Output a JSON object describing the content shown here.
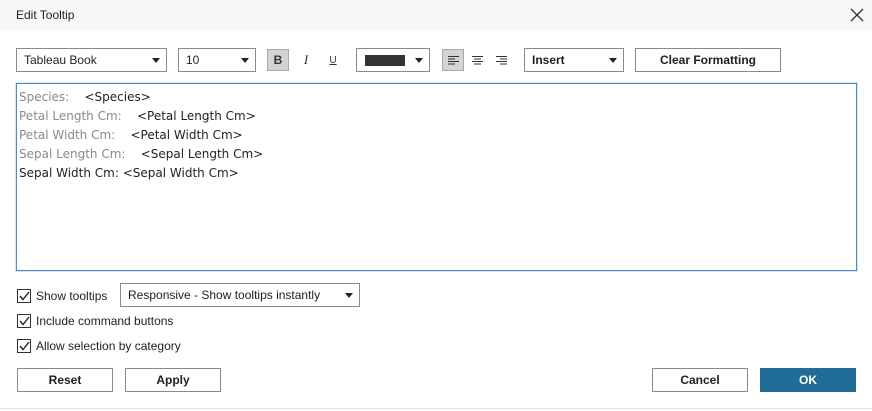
{
  "window": {
    "title": "Edit Tooltip",
    "close_icon": "close-icon"
  },
  "toolbar": {
    "font_family": "Tableau Book",
    "font_size": "10",
    "bold_label": "B",
    "italic_label": "I",
    "underline_label": "U",
    "text_color": "#333333",
    "align_left_icon": "align-left-icon",
    "align_center_icon": "align-center-icon",
    "align_right_icon": "align-right-icon",
    "insert_label": "Insert",
    "clear_formatting_label": "Clear Formatting"
  },
  "editor": {
    "lines": [
      {
        "label": "Species:",
        "field": "<Species>"
      },
      {
        "label": "Petal Length Cm:",
        "field": "<Petal Length Cm>"
      },
      {
        "label": "Petal Width Cm:",
        "field": "<Petal Width Cm>"
      },
      {
        "label": "Sepal Length Cm:",
        "field": "<Sepal Length Cm>"
      },
      {
        "label": "Sepal Width Cm:",
        "field": "<Sepal Width Cm>"
      }
    ]
  },
  "options": {
    "show_tooltips_label": "Show tooltips",
    "show_tooltips_checked": true,
    "tooltip_mode": "Responsive - Show tooltips instantly",
    "include_command_buttons_label": "Include command buttons",
    "include_command_buttons_checked": true,
    "allow_selection_label": "Allow selection by category",
    "allow_selection_checked": true
  },
  "footer": {
    "reset_label": "Reset",
    "apply_label": "Apply",
    "cancel_label": "Cancel",
    "ok_label": "OK"
  },
  "colors": {
    "primary_button": "#1f6c96",
    "editor_border": "#4b8cc9"
  }
}
